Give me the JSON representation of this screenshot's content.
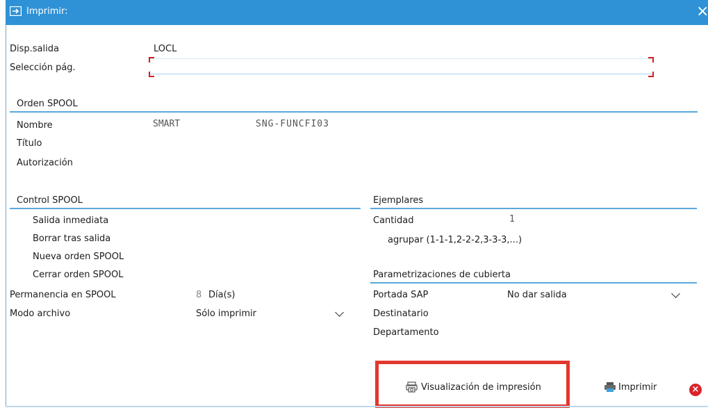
{
  "window": {
    "title": "Imprimir:",
    "close_glyph": "×"
  },
  "output": {
    "device_label": "Disp.salida",
    "device_value": "LOCL",
    "page_sel_label": "Selección pág."
  },
  "spool_order": {
    "heading": "Orden SPOOL",
    "name_label": "Nombre",
    "name_value1": "SMART",
    "name_value2": "SNG-FUNCFI03",
    "title_label": "Título",
    "auth_label": "Autorización"
  },
  "spool_control": {
    "heading": "Control SPOOL",
    "immediate": "Salida inmediata",
    "delete_after": "Borrar tras salida",
    "new_order": "Nueva orden SPOOL",
    "close_order": "Cerrar orden SPOOL",
    "retention_label": "Permanencia en SPOOL",
    "retention_value": "8",
    "retention_unit": "Día(s)",
    "archive_label": "Modo archivo",
    "archive_value": "Sólo imprimir"
  },
  "copies": {
    "heading": "Ejemplares",
    "qty_label": "Cantidad",
    "qty_value": "1",
    "group_label": "agrupar (1-1-1,2-2-2,3-3-3,...)"
  },
  "cover": {
    "heading": "Parametrizaciones de cubierta",
    "sap_cover_label": "Portada SAP",
    "sap_cover_value": "No dar salida",
    "recipient_label": "Destinatario",
    "department_label": "Departamento"
  },
  "footer": {
    "preview_label": "Visualización de impresión",
    "print_label": "Imprimir"
  },
  "colors": {
    "titlebar": "#2f92d6",
    "section_line": "#5aa7dd",
    "highlight": "#e2382d",
    "cancel": "#d9232a"
  }
}
